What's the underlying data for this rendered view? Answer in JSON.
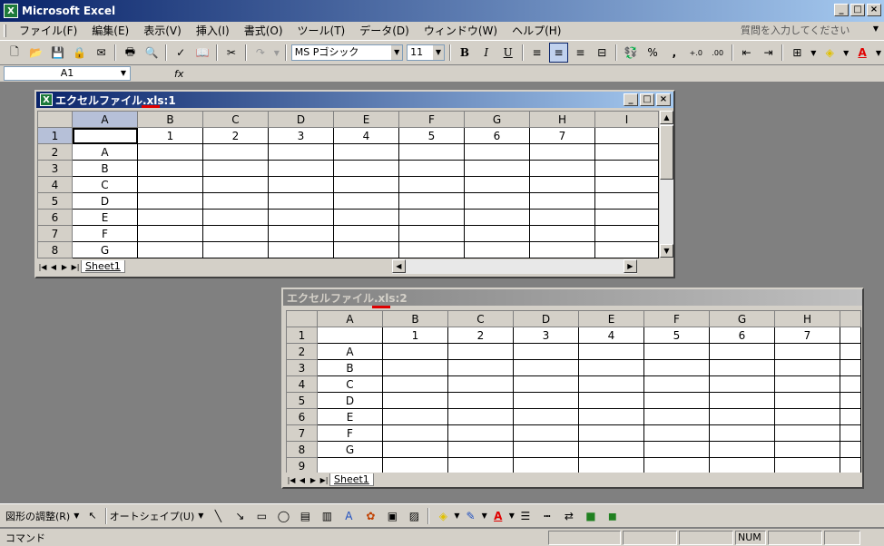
{
  "app": {
    "title": "Microsoft Excel",
    "icon": "excel-icon"
  },
  "menu": {
    "items": [
      "ファイル(F)",
      "編集(E)",
      "表示(V)",
      "挿入(I)",
      "書式(O)",
      "ツール(T)",
      "データ(D)",
      "ウィンドウ(W)",
      "ヘルプ(H)"
    ],
    "help_placeholder": "質問を入力してください"
  },
  "toolbar": {
    "font_name": "MS Pゴシック",
    "font_size": "11",
    "bold": "B",
    "italic": "I",
    "underline": "U",
    "percent": "%",
    "comma": ","
  },
  "formula": {
    "name_box": "A1",
    "fx": "fx",
    "value": ""
  },
  "book1": {
    "title": "エクセルファイル.xls:1",
    "columns": [
      "A",
      "B",
      "C",
      "D",
      "E",
      "F",
      "G",
      "H",
      "I"
    ],
    "rows": [
      {
        "num": "1",
        "cells": [
          "",
          "1",
          "2",
          "3",
          "4",
          "5",
          "6",
          "7",
          ""
        ]
      },
      {
        "num": "2",
        "cells": [
          "A",
          "",
          "",
          "",
          "",
          "",
          "",
          "",
          ""
        ]
      },
      {
        "num": "3",
        "cells": [
          "B",
          "",
          "",
          "",
          "",
          "",
          "",
          "",
          ""
        ]
      },
      {
        "num": "4",
        "cells": [
          "C",
          "",
          "",
          "",
          "",
          "",
          "",
          "",
          ""
        ]
      },
      {
        "num": "5",
        "cells": [
          "D",
          "",
          "",
          "",
          "",
          "",
          "",
          "",
          ""
        ]
      },
      {
        "num": "6",
        "cells": [
          "E",
          "",
          "",
          "",
          "",
          "",
          "",
          "",
          ""
        ]
      },
      {
        "num": "7",
        "cells": [
          "F",
          "",
          "",
          "",
          "",
          "",
          "",
          "",
          ""
        ]
      },
      {
        "num": "8",
        "cells": [
          "G",
          "",
          "",
          "",
          "",
          "",
          "",
          "",
          ""
        ]
      }
    ],
    "sheet_tab": "Sheet1"
  },
  "book2": {
    "title": "エクセルファイル.xls:2",
    "columns": [
      "A",
      "B",
      "C",
      "D",
      "E",
      "F",
      "G",
      "H"
    ],
    "rows": [
      {
        "num": "1",
        "cells": [
          "",
          "1",
          "2",
          "3",
          "4",
          "5",
          "6",
          "7"
        ]
      },
      {
        "num": "2",
        "cells": [
          "A",
          "",
          "",
          "",
          "",
          "",
          "",
          ""
        ]
      },
      {
        "num": "3",
        "cells": [
          "B",
          "",
          "",
          "",
          "",
          "",
          "",
          ""
        ]
      },
      {
        "num": "4",
        "cells": [
          "C",
          "",
          "",
          "",
          "",
          "",
          "",
          ""
        ]
      },
      {
        "num": "5",
        "cells": [
          "D",
          "",
          "",
          "",
          "",
          "",
          "",
          ""
        ]
      },
      {
        "num": "6",
        "cells": [
          "E",
          "",
          "",
          "",
          "",
          "",
          "",
          ""
        ]
      },
      {
        "num": "7",
        "cells": [
          "F",
          "",
          "",
          "",
          "",
          "",
          "",
          ""
        ]
      },
      {
        "num": "8",
        "cells": [
          "G",
          "",
          "",
          "",
          "",
          "",
          "",
          ""
        ]
      },
      {
        "num": "9",
        "cells": [
          "",
          "",
          "",
          "",
          "",
          "",
          "",
          ""
        ]
      }
    ],
    "sheet_tab": "Sheet1"
  },
  "drawing": {
    "adjust": "図形の調整(R)",
    "autoshapes": "オートシェイプ(U)"
  },
  "status": {
    "mode": "コマンド",
    "num": "NUM"
  },
  "colors": {
    "title_active": "#0a246a",
    "title_inactive": "#808080",
    "annotation": "#e00000",
    "chrome": "#d4d0c8"
  }
}
